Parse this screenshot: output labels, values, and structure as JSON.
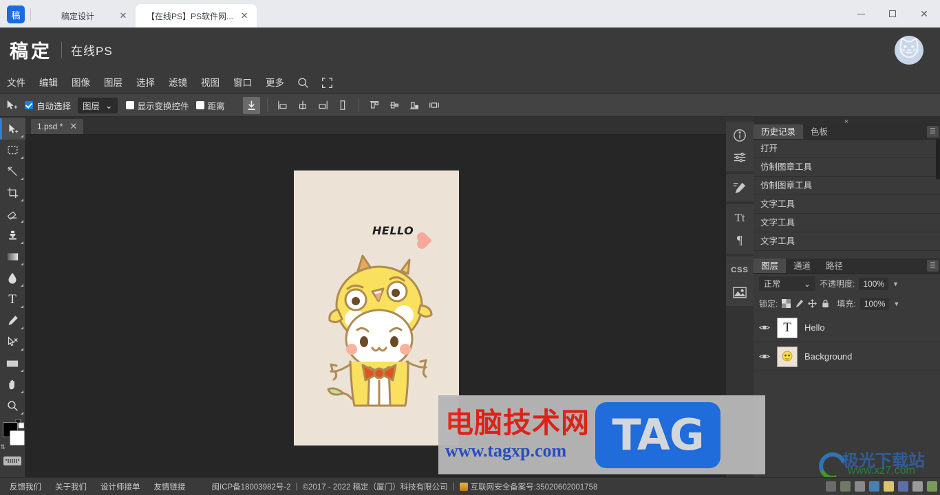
{
  "browser": {
    "brand_icon": "gaoding-logo-icon",
    "brand_text": "稿",
    "tabs": [
      {
        "title": "稿定设计",
        "active": false,
        "close": "✕"
      },
      {
        "title": "【在线PS】PS软件网...",
        "active": true,
        "close": "✕"
      }
    ],
    "window_controls": {
      "minimize": "minimize-icon",
      "maximize": "maximize-icon",
      "close": "✕"
    }
  },
  "site_header": {
    "logo": "稿定",
    "divider": "|",
    "subtitle": "在线PS",
    "avatar": "🐱"
  },
  "menubar": {
    "items": [
      "文件",
      "编辑",
      "图像",
      "图层",
      "选择",
      "滤镜",
      "视图",
      "窗口",
      "更多"
    ],
    "search_icon": "search-icon",
    "fullscreen_icon": "fullscreen-icon"
  },
  "optionsbar": {
    "move_tool_icon": "move-tool-icon",
    "auto_select": {
      "label": "自动选择",
      "checked": true
    },
    "target_select": {
      "value": "图层",
      "caret": "⌄"
    },
    "show_transform": {
      "label": "显示变换控件",
      "checked": false
    },
    "distance": {
      "label": "距离",
      "checked": false
    },
    "align_group_1": [
      "align-left-icon",
      "align-center-h-icon",
      "align-right-icon",
      "distribute-h-icon"
    ],
    "align_group_2": [
      "align-top-icon",
      "align-middle-v-icon",
      "align-bottom-icon",
      "distribute-v-icon"
    ],
    "download_icon": "download-icon"
  },
  "toolbar": {
    "tools": [
      {
        "name": "move-tool",
        "icon": "cursor-move-icon",
        "selected": true
      },
      {
        "name": "marquee-tool",
        "icon": "rectangular-marquee-icon",
        "selected": false
      },
      {
        "name": "magic-wand-tool",
        "icon": "magic-wand-icon",
        "selected": false
      },
      {
        "name": "crop-tool",
        "icon": "crop-icon",
        "selected": false
      },
      {
        "name": "eraser-tool",
        "icon": "eraser-icon",
        "selected": false
      },
      {
        "name": "clone-stamp-tool",
        "icon": "clone-stamp-icon",
        "selected": false
      },
      {
        "name": "gradient-tool",
        "icon": "gradient-icon",
        "selected": false
      },
      {
        "name": "blur-tool",
        "icon": "water-drop-icon",
        "selected": false
      },
      {
        "name": "type-tool",
        "icon": "text-T-icon",
        "selected": false
      },
      {
        "name": "pen-tool",
        "icon": "pen-icon",
        "selected": false
      },
      {
        "name": "path-select-tool",
        "icon": "path-select-icon",
        "selected": false
      },
      {
        "name": "shape-tool",
        "icon": "rectangle-shape-icon",
        "selected": false
      },
      {
        "name": "hand-tool",
        "icon": "hand-icon",
        "selected": false
      },
      {
        "name": "zoom-tool",
        "icon": "magnifier-icon",
        "selected": false
      }
    ],
    "foreground_color": "#000000",
    "background_color": "#ffffff",
    "swap_icon": "swap-colors-icon",
    "keyboard_icon": "keyboard-shortcuts-icon"
  },
  "document_tabs": [
    {
      "name": "1.psd *",
      "close": "✕",
      "active": true
    }
  ],
  "canvas": {
    "background_color": "#262626",
    "document": {
      "paper_color": "#ece3d6",
      "text_layer": "HELLO",
      "heart_color": "#f4a99a",
      "character": "yellow-chick-costume-illustration"
    }
  },
  "right_rail": {
    "icons": [
      "info-circle-icon",
      "adjustments-sliders-icon",
      "brush-settings-icon",
      "character-Tt-icon",
      "paragraph-pilcrow-icon",
      "css-icon",
      "image-icon"
    ]
  },
  "collapse": {
    "left_arrows": "‹›",
    "right_arrows": "›‹"
  },
  "history_panel": {
    "tabs": [
      {
        "label": "历史记录",
        "active": true
      },
      {
        "label": "色板",
        "active": false
      }
    ],
    "menu_icon": "panel-menu-icon",
    "items": [
      "打开",
      "仿制图章工具",
      "仿制图章工具",
      "文字工具",
      "文字工具",
      "文字工具"
    ]
  },
  "layers_panel": {
    "tabs": [
      {
        "label": "图层",
        "active": true
      },
      {
        "label": "通道",
        "active": false
      },
      {
        "label": "路径",
        "active": false
      }
    ],
    "menu_icon": "panel-menu-icon",
    "blend_mode": "正常",
    "blend_caret": "⌄",
    "opacity_label": "不透明度:",
    "opacity_value": "100%",
    "lock_label": "锁定:",
    "lock_icons": [
      "lock-transparent-icon",
      "lock-image-icon",
      "lock-position-icon",
      "lock-all-icon"
    ],
    "fill_label": "填充:",
    "fill_value": "100%",
    "layers": [
      {
        "name": "Hello",
        "thumb_type": "text-T",
        "visible": true,
        "eye_icon": "eye-icon"
      },
      {
        "name": "Background",
        "thumb_type": "image",
        "visible": true,
        "eye_icon": "eye-icon"
      }
    ]
  },
  "footer": {
    "links": [
      "反馈我们",
      "关于我们",
      "设计师接单",
      "友情链接"
    ],
    "icp": "闽ICP备18003982号-2",
    "sep1": "|",
    "copyright": "©2017 - 2022 稿定（厦门）科技有限公司",
    "sep2": "|",
    "security_icon": "police-badge-icon",
    "security": "互联网安全备案号:35020602001758",
    "tray_icons": [
      "link-icon",
      "eff-icon",
      "shield-icon",
      "globe-icon",
      "chat-icon",
      "media-icon",
      "grid-icon",
      "folder-icon"
    ]
  },
  "watermarks": {
    "main": {
      "cn_text": "电脑技术网",
      "url": "www.tagxp.com",
      "tag": "TAG",
      "cn_color": "#e2231a",
      "url_color": "#2a4fc4",
      "tag_bg": "#1f6fe0"
    },
    "corner": {
      "cn_text": "极光下载站",
      "url": "www.xz7.com"
    }
  }
}
